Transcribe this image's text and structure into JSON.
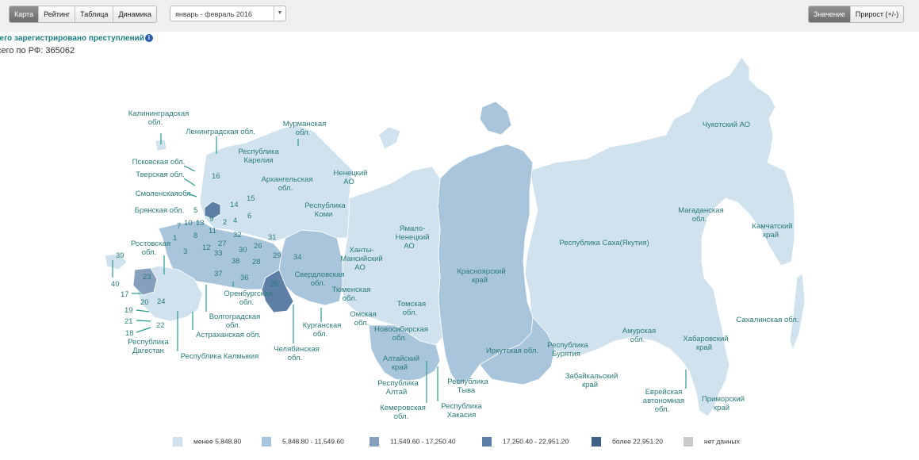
{
  "toolbar": {
    "tabs": [
      {
        "label": "Карта",
        "active": true
      },
      {
        "label": "Рейтинг",
        "active": false
      },
      {
        "label": "Таблица",
        "active": false
      },
      {
        "label": "Динамика",
        "active": false
      }
    ],
    "period": "январь - февраль 2016",
    "modes": [
      {
        "label": "Значение",
        "active": true
      },
      {
        "label": "Прирост (+/-)",
        "active": false
      }
    ]
  },
  "header": {
    "title": "сего зарегистрировано преступлений",
    "info_icon": "info-icon",
    "subtitle": "сего по РФ: 365062"
  },
  "map": {
    "regions": [
      {
        "text": [
          "Калининградская",
          "обл."
        ]
      },
      {
        "text": [
          "Ленинградская обл."
        ]
      },
      {
        "text": [
          "Мурманская",
          "обл."
        ]
      },
      {
        "text": [
          "Республика",
          "Карелия"
        ]
      },
      {
        "text": [
          "Псковская обл."
        ]
      },
      {
        "text": [
          "Тверская обл."
        ]
      },
      {
        "text": [
          "Смоленскаяобл."
        ]
      },
      {
        "text": [
          "Брянская обл."
        ]
      },
      {
        "text": [
          "Архангельская",
          "обл."
        ]
      },
      {
        "text": [
          "Ненецкий",
          "АО"
        ]
      },
      {
        "text": [
          "Республика",
          "Коми"
        ]
      },
      {
        "text": [
          "Ростовская",
          "обл."
        ]
      },
      {
        "text": [
          "Ямало-",
          "Ненецкий",
          "АО"
        ]
      },
      {
        "text": [
          "Ханты-",
          "Мансийский",
          "АО"
        ]
      },
      {
        "text": [
          "Свердловская",
          "обл."
        ]
      },
      {
        "text": [
          "Оренбургская",
          "обл."
        ]
      },
      {
        "text": [
          "Волгоградская",
          "обл."
        ]
      },
      {
        "text": [
          "Астраханская обл."
        ]
      },
      {
        "text": [
          "Республика",
          "Дагестан"
        ]
      },
      {
        "text": [
          "Республика Калмыкия"
        ]
      },
      {
        "text": [
          "Челябинская",
          "обл."
        ]
      },
      {
        "text": [
          "Курганская",
          "обл."
        ]
      },
      {
        "text": [
          "Тюменская",
          "обл."
        ]
      },
      {
        "text": [
          "Омская",
          "обл."
        ]
      },
      {
        "text": [
          "Томская",
          "обл."
        ]
      },
      {
        "text": [
          "Новосибирская",
          "обл."
        ]
      },
      {
        "text": [
          "Алтайский",
          "край"
        ]
      },
      {
        "text": [
          "Республика",
          "Алтай"
        ]
      },
      {
        "text": [
          "Кемеровская",
          "обл."
        ]
      },
      {
        "text": [
          "Республика",
          "Хакасия"
        ]
      },
      {
        "text": [
          "Республика",
          "Тыва"
        ]
      },
      {
        "text": [
          "Красноярский",
          "край"
        ]
      },
      {
        "text": [
          "Иркутская обл."
        ]
      },
      {
        "text": [
          "Республика",
          "Бурятия"
        ]
      },
      {
        "text": [
          "Забайкальский",
          "край"
        ]
      },
      {
        "text": [
          "Республика Саха(Якутия)"
        ]
      },
      {
        "text": [
          "Амурская",
          "обл."
        ]
      },
      {
        "text": [
          "Еврейская",
          "автономная",
          "обл."
        ]
      },
      {
        "text": [
          "Хабаровский",
          "край"
        ]
      },
      {
        "text": [
          "Приморский",
          "край"
        ]
      },
      {
        "text": [
          "Сахалинская обл."
        ]
      },
      {
        "text": [
          "Магаданская",
          "обл."
        ]
      },
      {
        "text": [
          "Камчатский",
          "край"
        ]
      },
      {
        "text": [
          "Чукотский АО"
        ]
      }
    ],
    "numbers": [
      "16",
      "15",
      "14",
      "6",
      "5",
      "9",
      "2",
      "4",
      "10",
      "13",
      "11",
      "7",
      "1",
      "8",
      "32",
      "12",
      "31",
      "3",
      "33",
      "27",
      "30",
      "26",
      "29",
      "34",
      "38",
      "28",
      "37",
      "36",
      "39",
      "40",
      "23",
      "25",
      "17",
      "20",
      "24",
      "19",
      "21",
      "22",
      "18"
    ]
  },
  "legend": [
    {
      "label": "менее 5,848.80",
      "color": "#cfe2ee"
    },
    {
      "label": "5,848.80 - 11,549.60",
      "color": "#a9c5dc"
    },
    {
      "label": "11,549.60 - 17,250.40",
      "color": "#859fbc"
    },
    {
      "label": "17,250.40 - 22,951.20",
      "color": "#5d7fa5"
    },
    {
      "label": "более 22,951.20",
      "color": "#3f5f86"
    },
    {
      "label": "нет данных",
      "color": "#c9c9c9"
    }
  ]
}
